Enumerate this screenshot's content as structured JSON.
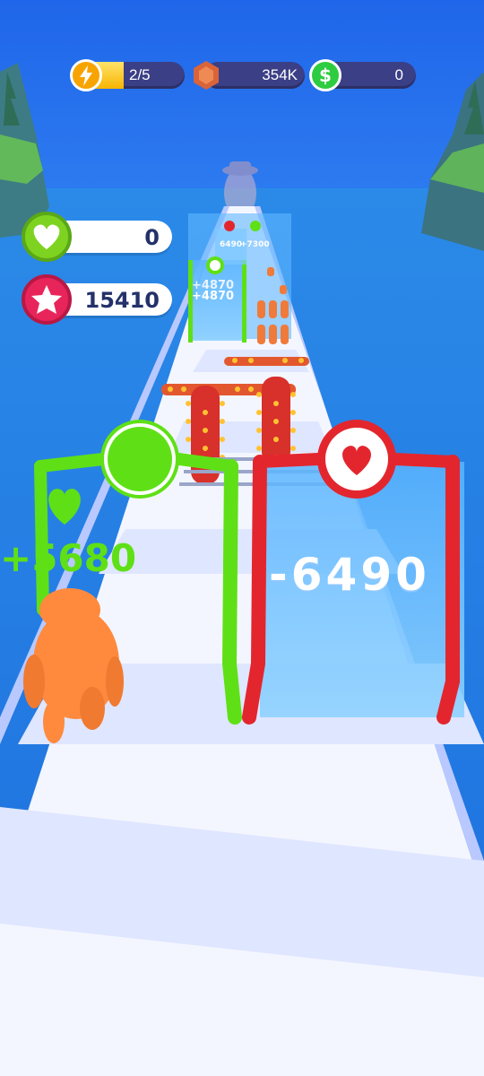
{
  "hud": {
    "energy": {
      "icon": "lightning-icon",
      "text": "2/5",
      "fill_fraction": 0.4,
      "color": "#f7b500"
    },
    "gems": {
      "icon": "gem-icon",
      "text": "354K",
      "color": "#d9643a"
    },
    "cash": {
      "icon": "dollar-icon",
      "symbol": "$",
      "text": "0",
      "color": "#2ecc40"
    }
  },
  "stats": {
    "hearts": {
      "icon": "heart-icon",
      "value": "0",
      "color": "#7ed321"
    },
    "stars": {
      "icon": "star-icon",
      "value": "15410",
      "color": "#e8255a"
    }
  },
  "gates": {
    "green_gate": {
      "icon": "circle-icon",
      "value": "+5680",
      "color": "#5fe016"
    },
    "red_gate": {
      "icon": "heart-icon",
      "value": "-6490",
      "color": "#e3262e"
    },
    "far_gates": {
      "values": [
        "+4870",
        "+4870",
        "+7300",
        "6490"
      ]
    }
  },
  "colors": {
    "sky": "#2f7ef0",
    "track": "#f4f6ff",
    "bear": "#ff8a3d",
    "spikes": "#e23a2a"
  }
}
